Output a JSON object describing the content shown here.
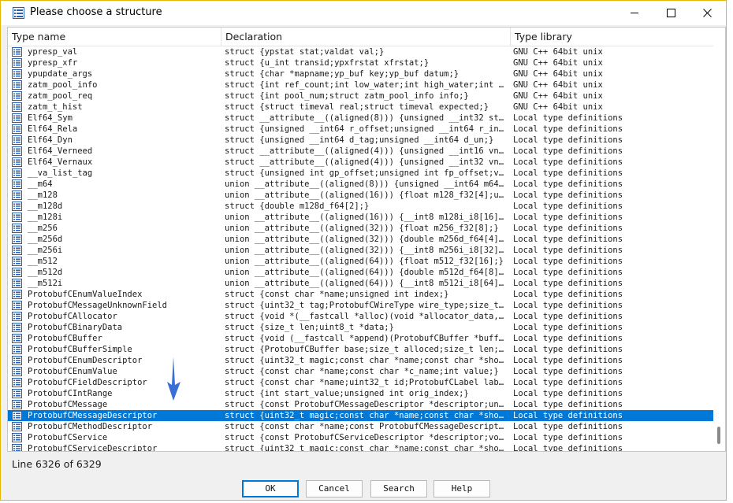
{
  "window": {
    "title": "Please choose a structure"
  },
  "columns": [
    "Type name",
    "Declaration",
    "Type library"
  ],
  "rows": [
    {
      "name": "ypresp_val",
      "decl": "struct {ypstat stat;valdat val;}",
      "lib": "GNU C++ 64bit unix"
    },
    {
      "name": "ypresp_xfr",
      "decl": "struct {u_int transid;ypxfrstat xfrstat;}",
      "lib": "GNU C++ 64bit unix"
    },
    {
      "name": "ypupdate_args",
      "decl": "struct {char *mapname;yp_buf key;yp_buf datum;}",
      "lib": "GNU C++ 64bit unix"
    },
    {
      "name": "zatm_pool_info",
      "decl": "struct {int ref_count;int low_water;int high_water;int rqa…",
      "lib": "GNU C++ 64bit unix"
    },
    {
      "name": "zatm_pool_req",
      "decl": "struct {int pool_num;struct zatm_pool_info info;}",
      "lib": "GNU C++ 64bit unix"
    },
    {
      "name": "zatm_t_hist",
      "decl": "struct {struct timeval real;struct timeval expected;}",
      "lib": "GNU C++ 64bit unix"
    },
    {
      "name": "Elf64_Sym",
      "decl": "struct __attribute__((aligned(8))) {unsigned __int32 st_na…",
      "lib": "Local type definitions"
    },
    {
      "name": "Elf64_Rela",
      "decl": "struct {unsigned __int64 r_offset;unsigned __int64 r_info;…",
      "lib": "Local type definitions"
    },
    {
      "name": "Elf64_Dyn",
      "decl": "struct {unsigned __int64 d_tag;unsigned __int64 d_un;}",
      "lib": "Local type definitions"
    },
    {
      "name": "Elf64_Verneed",
      "decl": "struct __attribute__((aligned(4))) {unsigned __int16 vn_ve…",
      "lib": "Local type definitions"
    },
    {
      "name": "Elf64_Vernaux",
      "decl": "struct __attribute__((aligned(4))) {unsigned __int32 vna_h…",
      "lib": "Local type definitions"
    },
    {
      "name": "__va_list_tag",
      "decl": "struct {unsigned int gp_offset;unsigned int fp_offset;void…",
      "lib": "Local type definitions"
    },
    {
      "name": "__m64",
      "decl": "union __attribute__((aligned(8))) {unsigned __int64 m64_u6…",
      "lib": "Local type definitions"
    },
    {
      "name": "__m128",
      "decl": "union __attribute__((aligned(16))) {float m128_f32[4];unsi…",
      "lib": "Local type definitions"
    },
    {
      "name": "__m128d",
      "decl": "struct {double m128d_f64[2];}",
      "lib": "Local type definitions"
    },
    {
      "name": "__m128i",
      "decl": "union __attribute__((aligned(16))) {__int8 m128i_i8[16];__…",
      "lib": "Local type definitions"
    },
    {
      "name": "__m256",
      "decl": "union __attribute__((aligned(32))) {float m256_f32[8];}",
      "lib": "Local type definitions"
    },
    {
      "name": "__m256d",
      "decl": "union __attribute__((aligned(32))) {double m256d_f64[4];}",
      "lib": "Local type definitions"
    },
    {
      "name": "__m256i",
      "decl": "union __attribute__((aligned(32))) {__int8 m256i_i8[32];__…",
      "lib": "Local type definitions"
    },
    {
      "name": "__m512",
      "decl": "union __attribute__((aligned(64))) {float m512_f32[16];}",
      "lib": "Local type definitions"
    },
    {
      "name": "__m512d",
      "decl": "union __attribute__((aligned(64))) {double m512d_f64[8];}",
      "lib": "Local type definitions"
    },
    {
      "name": "__m512i",
      "decl": "union __attribute__((aligned(64))) {__int8 m512i_i8[64];__…",
      "lib": "Local type definitions"
    },
    {
      "name": "ProtobufCEnumValueIndex",
      "decl": "struct {const char *name;unsigned int index;}",
      "lib": "Local type definitions"
    },
    {
      "name": "ProtobufCMessageUnknownField",
      "decl": "struct {uint32_t tag;ProtobufCWireType wire_type;size_t le…",
      "lib": "Local type definitions"
    },
    {
      "name": "ProtobufCAllocator",
      "decl": "struct {void *(__fastcall *alloc)(void *allocator_data, si…",
      "lib": "Local type definitions"
    },
    {
      "name": "ProtobufCBinaryData",
      "decl": "struct {size_t len;uint8_t *data;}",
      "lib": "Local type definitions"
    },
    {
      "name": "ProtobufCBuffer",
      "decl": "struct {void (__fastcall *append)(ProtobufCBuffer *buffer,…",
      "lib": "Local type definitions"
    },
    {
      "name": "ProtobufCBufferSimple",
      "decl": "struct {ProtobufCBuffer base;size_t alloced;size_t len;uin…",
      "lib": "Local type definitions"
    },
    {
      "name": "ProtobufCEnumDescriptor",
      "decl": "struct {uint32_t magic;const char *name;const char *short_…",
      "lib": "Local type definitions"
    },
    {
      "name": "ProtobufCEnumValue",
      "decl": "struct {const char *name;const char *c_name;int value;}",
      "lib": "Local type definitions"
    },
    {
      "name": "ProtobufCFieldDescriptor",
      "decl": "struct {const char *name;uint32_t id;ProtobufCLabel label;…",
      "lib": "Local type definitions"
    },
    {
      "name": "ProtobufCIntRange",
      "decl": "struct {int start_value;unsigned int orig_index;}",
      "lib": "Local type definitions"
    },
    {
      "name": "ProtobufCMessage",
      "decl": "struct {const ProtobufCMessageDescriptor *descriptor;unsig…",
      "lib": "Local type definitions"
    },
    {
      "name": "ProtobufCMessageDescriptor",
      "decl": "struct {uint32_t magic;const char *name;const char *short_…",
      "lib": "Local type definitions",
      "selected": true
    },
    {
      "name": "ProtobufCMethodDescriptor",
      "decl": "struct {const char *name;const ProtobufCMessageDescriptor …",
      "lib": "Local type definitions"
    },
    {
      "name": "ProtobufCService",
      "decl": "struct {const ProtobufCServiceDescriptor *descriptor;void …",
      "lib": "Local type definitions"
    },
    {
      "name": "ProtobufCServiceDescriptor",
      "decl": "struct {uint32_t magic;const char *name;const char *short_…",
      "lib": "Local type definitions"
    }
  ],
  "status": "Line 6326 of 6329",
  "buttons": {
    "ok": "OK",
    "cancel": "Cancel",
    "search": "Search",
    "help": "Help"
  },
  "colors": {
    "selection": "#0078d7",
    "arrow": "#3a6fd8"
  }
}
